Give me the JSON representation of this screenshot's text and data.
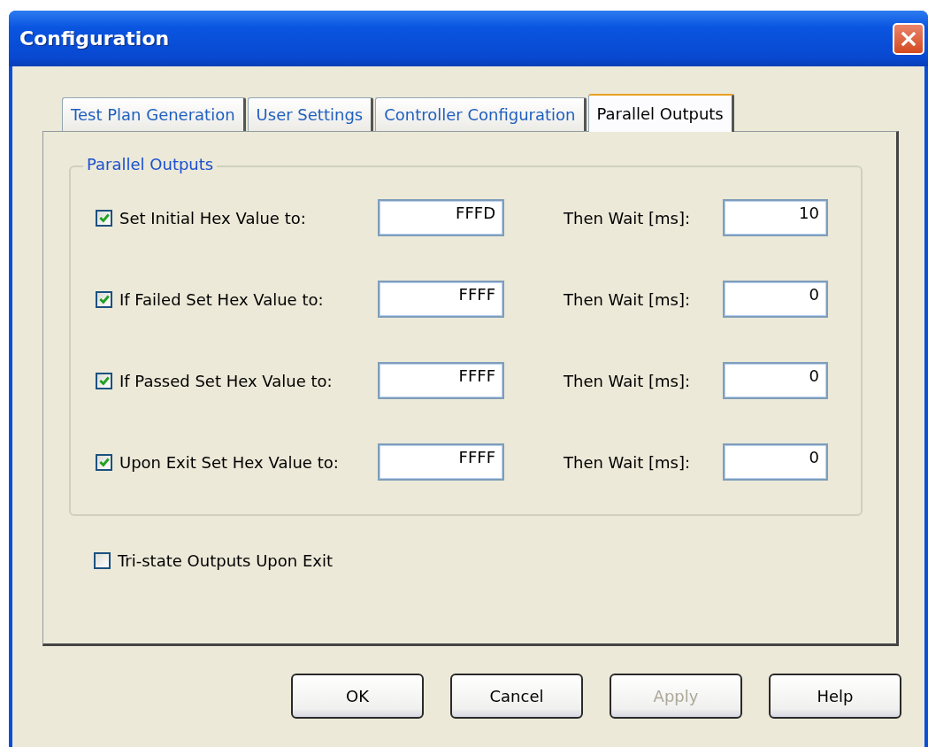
{
  "window": {
    "title": "Configuration"
  },
  "tabs": [
    {
      "label": "Test Plan Generation",
      "selected": false
    },
    {
      "label": "User Settings",
      "selected": false
    },
    {
      "label": "Controller Configuration",
      "selected": false
    },
    {
      "label": "Parallel Outputs",
      "selected": true
    }
  ],
  "group": {
    "title": "Parallel Outputs",
    "rows": [
      {
        "label": "Set Initial Hex Value to:",
        "checked": true,
        "hex_value": "FFFD",
        "wait_label": "Then Wait [ms]:",
        "wait_value": "10"
      },
      {
        "label": "If Failed Set Hex Value to:",
        "checked": true,
        "hex_value": "FFFF",
        "wait_label": "Then Wait [ms]:",
        "wait_value": "0"
      },
      {
        "label": "If Passed Set Hex Value to:",
        "checked": true,
        "hex_value": "FFFF",
        "wait_label": "Then Wait [ms]:",
        "wait_value": "0"
      },
      {
        "label": "Upon Exit Set Hex Value to:",
        "checked": true,
        "hex_value": "FFFF",
        "wait_label": "Then Wait [ms]:",
        "wait_value": "0"
      }
    ]
  },
  "tristate": {
    "label": "Tri-state Outputs Upon Exit",
    "checked": false
  },
  "buttons": [
    {
      "label": "OK",
      "disabled": false
    },
    {
      "label": "Cancel",
      "disabled": false
    },
    {
      "label": "Apply",
      "disabled": true
    },
    {
      "label": "Help",
      "disabled": false
    }
  ]
}
